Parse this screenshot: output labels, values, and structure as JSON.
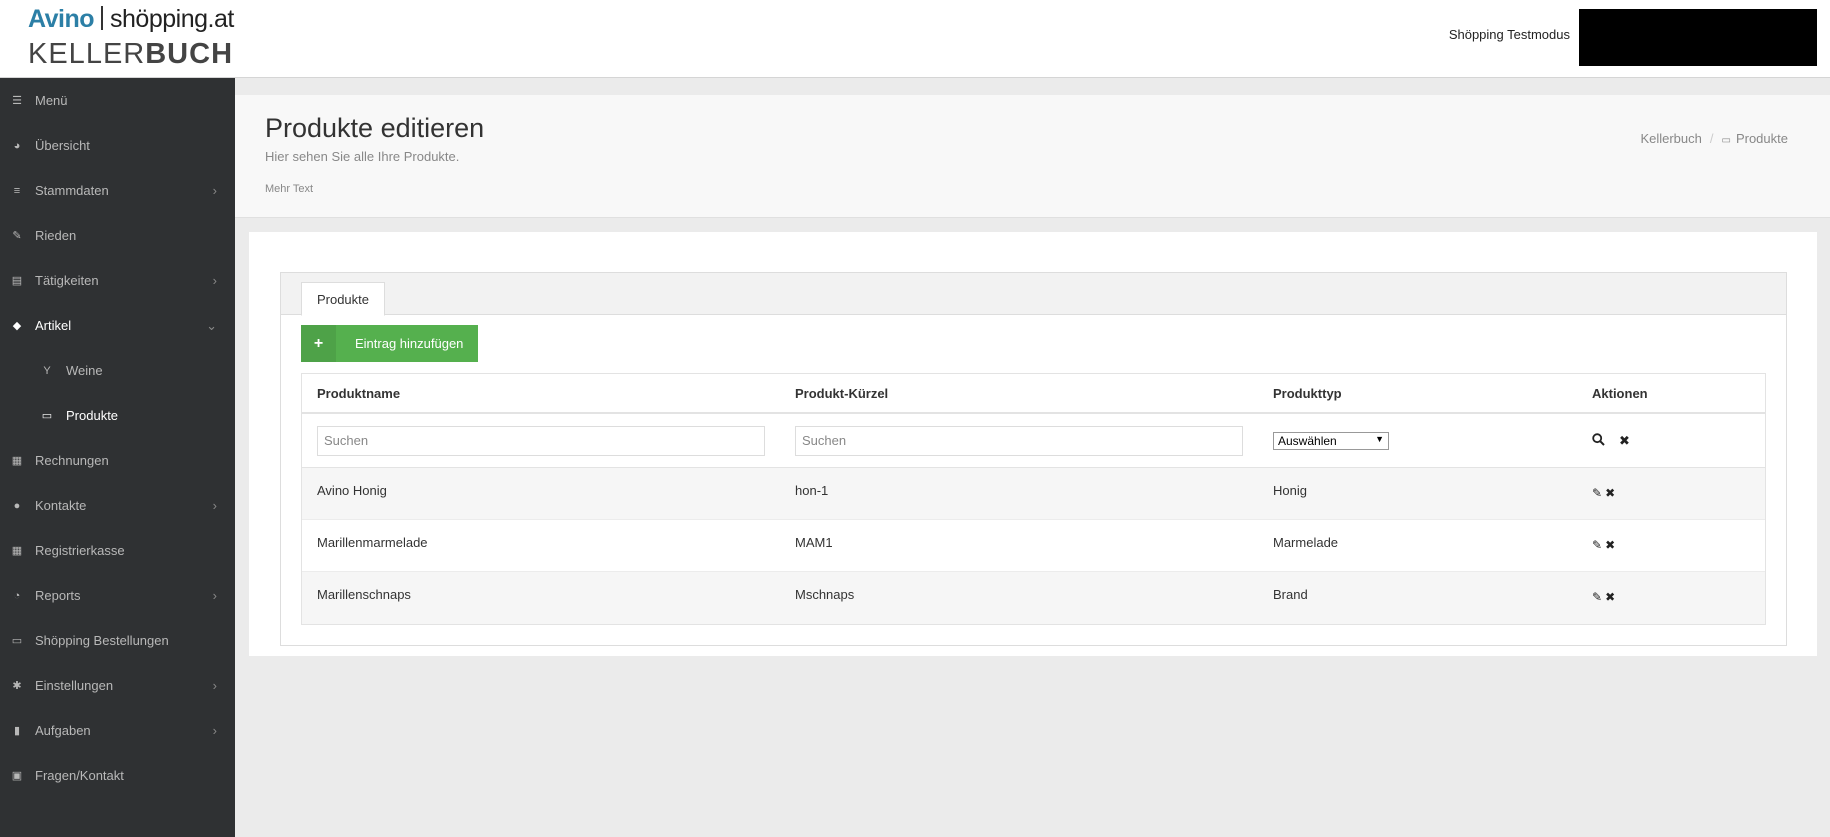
{
  "header": {
    "logo_brand": "Avino",
    "logo_shop": "shöpping.at",
    "logo_word1": "KELLER",
    "logo_word2": "BUCH",
    "test_mode": "Shöpping Testmodus"
  },
  "sidebar": {
    "items": [
      {
        "label": "Menü",
        "icon": "☰"
      },
      {
        "label": "Übersicht",
        "icon": "◕"
      },
      {
        "label": "Stammdaten",
        "icon": "≡",
        "chevron": "›"
      },
      {
        "label": "Rieden",
        "icon": "✎"
      },
      {
        "label": "Tätigkeiten",
        "icon": "▤",
        "chevron": "›"
      },
      {
        "label": "Artikel",
        "icon": "◆",
        "chevron": "⌄"
      },
      {
        "label": "Weine",
        "icon": "Y"
      },
      {
        "label": "Produkte",
        "icon": "▭"
      },
      {
        "label": "Rechnungen",
        "icon": "▦"
      },
      {
        "label": "Kontakte",
        "icon": "●",
        "chevron": "›"
      },
      {
        "label": "Registrierkasse",
        "icon": "▦"
      },
      {
        "label": "Reports",
        "icon": "◔",
        "chevron": "›"
      },
      {
        "label": "Shöpping Bestellungen",
        "icon": "▭"
      },
      {
        "label": "Einstellungen",
        "icon": "✱",
        "chevron": "›"
      },
      {
        "label": "Aufgaben",
        "icon": "▮",
        "chevron": "›"
      },
      {
        "label": "Fragen/Kontakt",
        "icon": "▣"
      }
    ]
  },
  "page": {
    "title": "Produkte editieren",
    "subtitle": "Hier sehen Sie alle Ihre Produkte.",
    "more": "Mehr Text",
    "breadcrumb": [
      "Kellerbuch",
      "Produkte"
    ],
    "breadcrumb_sep": "/"
  },
  "tabs": [
    {
      "label": "Produkte"
    }
  ],
  "add_button": {
    "icon": "+",
    "label": "Eintrag hinzufügen"
  },
  "table": {
    "columns": [
      "Produktname",
      "Produkt-Kürzel",
      "Produkttyp",
      "Aktionen"
    ],
    "filters": {
      "name_placeholder": "Suchen",
      "code_placeholder": "Suchen",
      "type_value": "Auswählen"
    },
    "rows": [
      {
        "name": "Avino Honig",
        "code": "hon-1",
        "type": "Honig"
      },
      {
        "name": "Marillenmarmelade",
        "code": "MAM1",
        "type": "Marmelade"
      },
      {
        "name": "Marillenschnaps",
        "code": "Mschnaps",
        "type": "Brand"
      }
    ]
  },
  "colors": {
    "sidebar_bg": "#2f3133",
    "accent_green": "#55b04e",
    "logo_blue": "#2c7fa6"
  }
}
